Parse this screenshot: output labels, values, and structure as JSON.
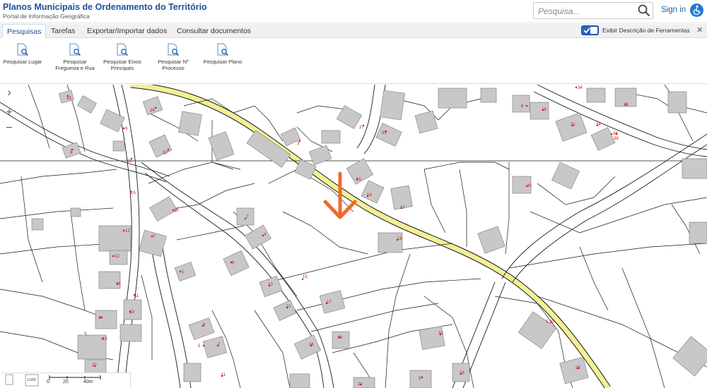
{
  "header": {
    "title": "Planos Municipais de Ordenamento do Território",
    "subtitle": "Portal de Informação Geográfica",
    "search_placeholder": "Pesquisa...",
    "signin_label": "Sign in"
  },
  "tabs": [
    {
      "label": "Pesquisas",
      "active": true
    },
    {
      "label": "Tarefas"
    },
    {
      "label": "Exportar/Importar dados"
    },
    {
      "label": "Consultar documentos"
    }
  ],
  "toggle": {
    "label": "Exibir Descrição de Ferramentas",
    "checked": true
  },
  "tools": [
    {
      "label": "Pesquisar Lugar"
    },
    {
      "label": "Pesquisar Freguesia e Rua"
    },
    {
      "label": "Pesquisar Eixos Principais"
    },
    {
      "label": "Pesquisar Nº Processo"
    },
    {
      "label": "Pesquisar Plano"
    }
  ],
  "map": {
    "labels": [
      "33",
      "9",
      "24",
      "34",
      "8",
      "32",
      "33",
      "3",
      "27",
      "35",
      "6",
      "34",
      "23",
      "31",
      "16",
      "15",
      "19",
      "17",
      "38",
      "18",
      "40",
      "12",
      "7",
      "30",
      "7",
      "4",
      "13",
      "15",
      "16",
      "1",
      "6",
      "10",
      "11",
      "19",
      "14",
      "17",
      "15",
      "8",
      "21",
      "13",
      "31",
      "16",
      "19",
      "5",
      "7",
      "22",
      "11",
      "21",
      "3",
      "16",
      "38",
      "5.30",
      "23"
    ],
    "scale": {
      "label_0": "0",
      "label_20": "20",
      "label_40": "40m",
      "ratio_badge": "1:500"
    }
  },
  "colors": {
    "accent": "#1f4e99",
    "road_fill": "#f3ef96",
    "parcel_line": "#1a1a1a",
    "building": "#c8c8c8",
    "arrow": "#ef6a2a",
    "point": "#d01010"
  },
  "icons": {
    "search": "magnifier-icon",
    "accessibility": "accessibility-icon",
    "expand": "chevron-right-icon",
    "zoom_in": "plus-icon",
    "zoom_out": "minus-icon"
  }
}
